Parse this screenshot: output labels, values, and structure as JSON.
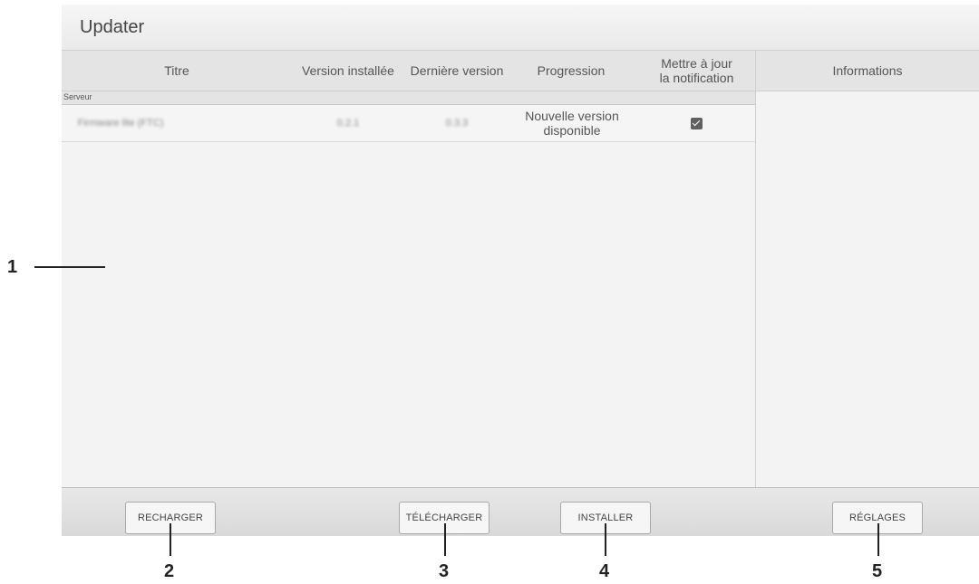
{
  "window": {
    "title": "Updater"
  },
  "table": {
    "columns": [
      "Titre",
      "Version installée",
      "Dernière version",
      "Progression",
      "Mettre à jour\nla notification"
    ],
    "group_label": "Serveur",
    "rows": [
      {
        "title": "Firmware lite (FTC)",
        "installed_version": "0.2.1",
        "latest_version": "0.3.3",
        "progress": "Nouvelle version disponible",
        "notify": true
      }
    ]
  },
  "info_panel": {
    "header": "Informations"
  },
  "footer": {
    "reload_label": "RECHARGER",
    "download_label": "TÉLÉCHARGER",
    "install_label": "INSTALLER",
    "settings_label": "RÉGLAGES"
  },
  "callouts": [
    "1",
    "2",
    "3",
    "4",
    "5"
  ]
}
